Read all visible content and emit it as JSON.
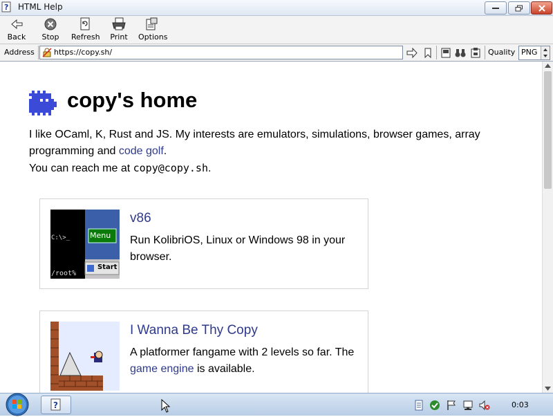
{
  "window": {
    "title": "HTML Help"
  },
  "toolbar": {
    "back_label": "Back",
    "stop_label": "Stop",
    "refresh_label": "Refresh",
    "print_label": "Print",
    "options_label": "Options"
  },
  "address": {
    "label": "Address",
    "url": "https://copy.sh/",
    "quality_label": "Quality",
    "quality_value": "PNG"
  },
  "page": {
    "title": "copy's home",
    "intro_1": "I like OCaml, K, Rust and JS. My interests are emulators, simulations, browser games, array programming and ",
    "intro_link": "code golf",
    "intro_1_end": ".",
    "intro_2": "You can reach me at ",
    "email": "copy@copy.sh",
    "intro_2_end": "."
  },
  "cards": [
    {
      "title": "v86",
      "desc": "Run KolibriOS, Linux or Windows 98 in your browser.",
      "thumb_texts": {
        "prompt": "C:\\>_",
        "menu": "Menu",
        "root": "/root%",
        "start": "Start"
      }
    },
    {
      "title": "I Wanna Be Thy Copy",
      "desc_1": "A platformer fangame with 2 levels so far. The ",
      "desc_link": "game engine",
      "desc_2": " is available."
    }
  ],
  "taskbar": {
    "clock": "0:03"
  },
  "colors": {
    "link": "#2e3a8c",
    "logo": "#3b4bd8"
  }
}
